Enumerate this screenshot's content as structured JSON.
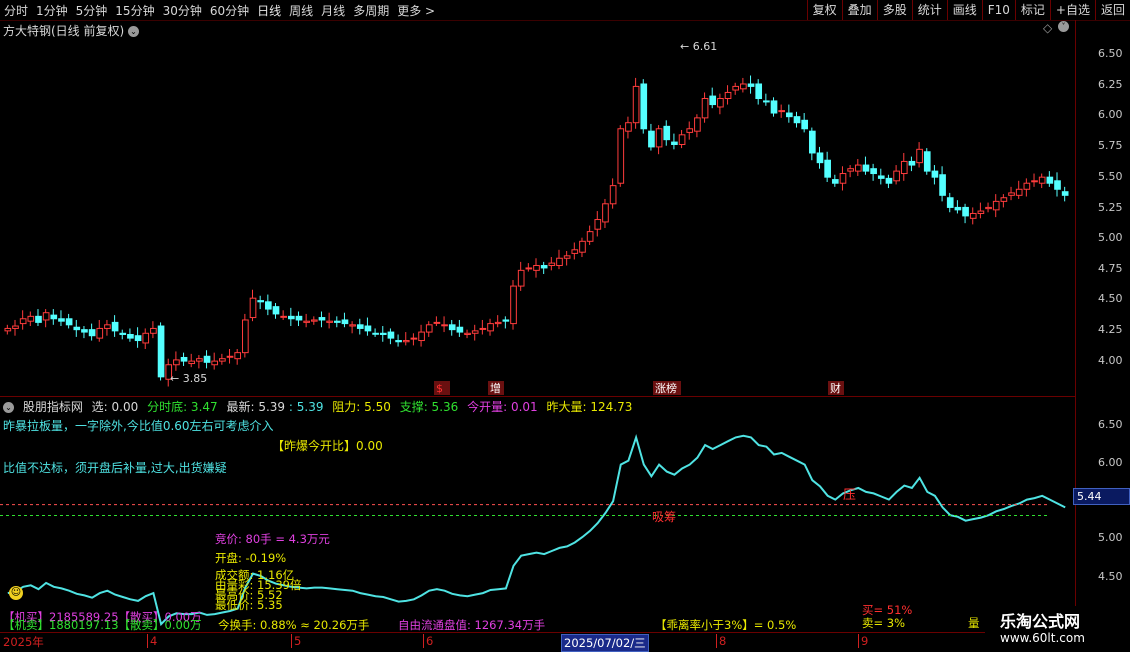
{
  "toolbar": {
    "periods": [
      "分时",
      "1分钟",
      "5分钟",
      "15分钟",
      "30分钟",
      "60分钟",
      "日线",
      "周线",
      "月线",
      "多周期",
      "更多 >"
    ],
    "buttons": [
      "复权",
      "叠加",
      "多股",
      "统计",
      "画线",
      "F10",
      "标记",
      "+自选",
      "返回"
    ]
  },
  "title": "方大特钢(日线 前复权)",
  "price_axis": [
    "6.50",
    "6.25",
    "6.00",
    "5.75",
    "5.50",
    "5.25",
    "5.00",
    "4.75",
    "4.50",
    "4.25",
    "4.00"
  ],
  "ind_axis": [
    "6.50",
    "6.00",
    "5.44",
    "5.00",
    "4.50"
  ],
  "markers": {
    "high": "6.61",
    "low": "3.85"
  },
  "events": [
    "$",
    "增",
    "涨榜",
    "财"
  ],
  "indicator": {
    "name": "股朋指标网",
    "xuan": "选: 0.00",
    "fenshidi": "分时底: 3.47",
    "zuixin": "最新: 5.39",
    "last": ": 5.39",
    "zuli": "阻力: 5.50",
    "zhicheng": "支撑: 5.36",
    "jinkailiang": "今开量: 0.01",
    "zuodaliang": "昨大量: 124.73"
  },
  "notes": {
    "n1": "昨暴拉板量，一字除外,今比值0.60左右可考虑介入",
    "n2": "比值不达标，须开盘后补量,过大,出货嫌疑",
    "n3": "【昨爆今开比】0.00",
    "ya": "压",
    "xishou": "吸筹"
  },
  "popup": {
    "jingjia": "竞价: 80手 = 4.3万元",
    "kaipan": "开盘: -0.19%",
    "chengjiao": "成交额: 1.16亿",
    "liutong": "由量彩: 15.39倍",
    "zuigao": "最高价: 5.52",
    "zuidi": "最低价: 5.35"
  },
  "bottom": {
    "b1": "【机买】2185589.25【散买】0.00万",
    "b2": "【机卖】1880197.13【散卖】0.00万",
    "b3": "今换手: 0.88% ≈ 20.26万手",
    "b4": "自由流通盘值: 1267.34万手",
    "b5": "【乖离率小于3%】= 0.5%",
    "b6": "买= 51%",
    "b7": "卖= 3%",
    "b8": "量"
  },
  "dates": [
    "2025年",
    "4",
    "5",
    "6",
    "2025/07/02/三",
    "8",
    "9"
  ],
  "watermark": {
    "line1": "乐淘公式网",
    "line2": "www.60lt.com"
  },
  "current_price": "5.44",
  "chart_data": {
    "type": "candlestick",
    "ylim": [
      3.75,
      6.7
    ],
    "closes": [
      4.3,
      4.32,
      4.38,
      4.4,
      4.35,
      4.43,
      4.38,
      4.36,
      4.33,
      4.29,
      4.27,
      4.24,
      4.3,
      4.33,
      4.28,
      4.25,
      4.22,
      4.2,
      4.26,
      4.3,
      3.9,
      4.0,
      4.04,
      4.03,
      4.03,
      4.05,
      4.02,
      4.03,
      4.05,
      4.07,
      4.1,
      4.37,
      4.55,
      4.52,
      4.46,
      4.42,
      4.4,
      4.38,
      4.37,
      4.36,
      4.37,
      4.37,
      4.36,
      4.35,
      4.34,
      4.33,
      4.3,
      4.28,
      4.26,
      4.25,
      4.22,
      4.19,
      4.2,
      4.22,
      4.27,
      4.33,
      4.35,
      4.33,
      4.29,
      4.27,
      4.26,
      4.28,
      4.3,
      4.34,
      4.35,
      4.36,
      4.65,
      4.78,
      4.8,
      4.82,
      4.8,
      4.84,
      4.88,
      4.9,
      4.95,
      5.02,
      5.1,
      5.2,
      5.33,
      5.48,
      5.95,
      6.0,
      6.3,
      5.95,
      5.8,
      5.95,
      5.86,
      5.82,
      5.9,
      5.95,
      6.04,
      6.2,
      6.15,
      6.2,
      6.25,
      6.3,
      6.32,
      6.3,
      6.2,
      6.18,
      6.08,
      6.1,
      6.05,
      6.0,
      5.95,
      5.75,
      5.67,
      5.55,
      5.5,
      5.58,
      5.62,
      5.65,
      5.6,
      5.58,
      5.54,
      5.5,
      5.6,
      5.68,
      5.65,
      5.78,
      5.6,
      5.55,
      5.4,
      5.3,
      5.28,
      5.23,
      5.25,
      5.27,
      5.3,
      5.35,
      5.38,
      5.42,
      5.45,
      5.5,
      5.52,
      5.55,
      5.5,
      5.45,
      5.4
    ]
  }
}
